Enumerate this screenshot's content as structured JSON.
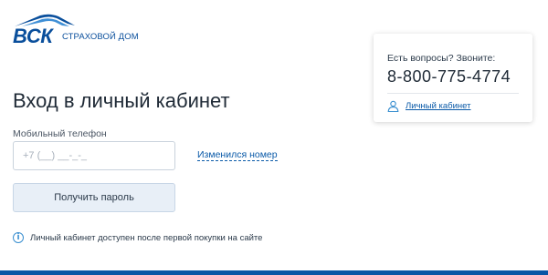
{
  "header": {
    "logo_text": "ВСК",
    "logo_subtitle": "СТРАХОВОЙ ДОМ"
  },
  "main": {
    "title": "Вход в личный кабинет",
    "phone_label": "Мобильный телефон",
    "phone_placeholder": "+7 (__) __-_-_",
    "phone_value": "",
    "changed_number_link": "Изменился номер",
    "submit_label": "Получить пароль",
    "info_icon": "i",
    "info_text": "Личный кабинет доступен после первой покупки на сайте"
  },
  "contact_card": {
    "question": "Есть вопросы? Звоните:",
    "phone": "8-800-775-4774",
    "account_link": "Личный кабинет"
  },
  "colors": {
    "brand_blue": "#0a4f9c",
    "link_blue": "#0a5aa8",
    "button_bg": "#e8eff7",
    "bottom_bar": "#0a56a5"
  },
  "icons": {
    "logo": "vsk-roof-logo",
    "info": "info-circle-icon",
    "user": "user-icon"
  }
}
